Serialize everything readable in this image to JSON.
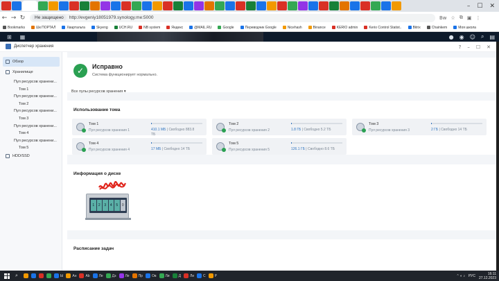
{
  "browser": {
    "security": "Не защищено",
    "url": "http://evgeniy18051979.synology.me:5000",
    "right_controls": [
      "Bw",
      "☆",
      "⧉",
      "▣",
      "⋮"
    ],
    "window_controls": [
      "–",
      "☐",
      "✕"
    ],
    "tab_colors": [
      "#d93025",
      "#1a73e8",
      "#34a853",
      "#f29900",
      "#1a73e8",
      "#d93025",
      "#188038",
      "#e37400",
      "#9334e6",
      "#1a73e8",
      "#d93025",
      "#34a853",
      "#1a73e8",
      "#f29900",
      "#d93025",
      "#188038",
      "#1a73e8",
      "#9334e6",
      "#e37400",
      "#34a853",
      "#1a73e8",
      "#d93025",
      "#188038",
      "#1a73e8",
      "#f29900",
      "#d93025",
      "#34a853",
      "#9334e6",
      "#1a73e8",
      "#d93025",
      "#188038",
      "#e37400",
      "#1a73e8",
      "#d93025",
      "#34a853",
      "#1a73e8",
      "#f29900"
    ]
  },
  "bookmarks": [
    {
      "label": "Bookmarks",
      "color": "#555"
    },
    {
      "label": "Шк ПОРТАЛ",
      "color": "#e37400"
    },
    {
      "label": "Хвартальта",
      "color": "#1a73e8"
    },
    {
      "label": "Skyeng",
      "color": "#1a73e8"
    },
    {
      "label": "UCH.RU",
      "color": "#188038"
    },
    {
      "label": "NB system",
      "color": "#d93025"
    },
    {
      "label": "Яндекс",
      "color": "#d93025"
    },
    {
      "label": "@MAIL.RU",
      "color": "#1a73e8"
    },
    {
      "label": "Google",
      "color": "#34a853"
    },
    {
      "label": "Переводчик Google",
      "color": "#1a73e8"
    },
    {
      "label": "Nicehash",
      "color": "#f29900"
    },
    {
      "label": "Binance",
      "color": "#f29900"
    },
    {
      "label": "KERIO admin",
      "color": "#d93025"
    },
    {
      "label": "Kerio Control Statist..",
      "color": "#d93025"
    },
    {
      "label": "Bitrix",
      "color": "#1a73e8"
    },
    {
      "label": "Chainkem",
      "color": "#555"
    },
    {
      "label": "Моя школа",
      "color": "#1a73e8"
    }
  ],
  "window": {
    "title": "Диспетчер хранения",
    "controls": [
      "?",
      "–",
      "☐",
      "✕"
    ]
  },
  "sidebar": {
    "overview": "Обзор",
    "storage": "Хранилище",
    "items": [
      {
        "label": "Пул ресурсов хранени...",
        "level": 1
      },
      {
        "label": "Том 1",
        "level": 2
      },
      {
        "label": "Пул ресурсов хранени...",
        "level": 1
      },
      {
        "label": "Том 2",
        "level": 2
      },
      {
        "label": "Пул ресурсов хранени...",
        "level": 1
      },
      {
        "label": "Том 3",
        "level": 2
      },
      {
        "label": "Пул ресурсов хранени...",
        "level": 1
      },
      {
        "label": "Том 4",
        "level": 2
      },
      {
        "label": "Пул ресурсов хранени...",
        "level": 1
      },
      {
        "label": "Том 5",
        "level": 2
      }
    ],
    "hdd": "HDD/SSD"
  },
  "status": {
    "title": "Исправно",
    "subtitle": "Система функционирует нормально.",
    "pools_link": "Все пулы ресурсов хранения"
  },
  "volume_usage": {
    "heading": "Использование тома",
    "volumes": [
      {
        "name": "Том 1",
        "pool": "Пул ресурсов хранения 1",
        "used": "410.1 МБ",
        "free": "| Свободно 883.8",
        "free2": "ТБ",
        "fill": 0.01
      },
      {
        "name": "Том 2",
        "pool": "Пул ресурсов хранения 2",
        "used": "1.8 ГБ",
        "free": "| Свободно 5.2 ТБ",
        "free2": "",
        "fill": 0.01
      },
      {
        "name": "Том 3",
        "pool": "Пул ресурсов хранения 3",
        "used": "2 ГБ",
        "free": "| Свободно 14 ТБ",
        "free2": "",
        "fill": 0.01
      },
      {
        "name": "Том 4",
        "pool": "Пул ресурсов хранения 4",
        "used": "17 МБ",
        "free": "| Свободно 14 ТБ",
        "free2": "",
        "fill": 0.01
      },
      {
        "name": "Том 5",
        "pool": "Пул ресурсов хранения 5",
        "used": "126.1 ГБ",
        "free": "| Свободно 8.6 ТБ",
        "free2": "",
        "fill": 0.02
      }
    ]
  },
  "disk_info": {
    "heading": "Информация о диске",
    "bays": [
      "1",
      "2",
      "3",
      "4",
      "5",
      "0"
    ]
  },
  "schedule": {
    "heading": "Расписание задач"
  },
  "taskbar": {
    "apps": [
      {
        "label": "",
        "color": "#f29900"
      },
      {
        "label": "",
        "color": "#1a73e8"
      },
      {
        "label": "",
        "color": "#d93025"
      },
      {
        "label": "",
        "color": "#34a853"
      },
      {
        "label": "Ы",
        "color": "#1a73e8"
      },
      {
        "label": "Ан",
        "color": "#f29900"
      },
      {
        "label": "Ab",
        "color": "#d93025"
      },
      {
        "label": "Ле",
        "color": "#1a73e8"
      },
      {
        "label": "Дз",
        "color": "#34a853"
      },
      {
        "label": "Ле",
        "color": "#9334e6"
      },
      {
        "label": "Пр",
        "color": "#e37400"
      },
      {
        "label": "Ов",
        "color": "#1a73e8"
      },
      {
        "label": "Ли",
        "color": "#34a853"
      },
      {
        "label": "Д",
        "color": "#188038"
      },
      {
        "label": "Ли",
        "color": "#d93025"
      },
      {
        "label": "С",
        "color": "#1a73e8"
      },
      {
        "label": "Р",
        "color": "#f29900"
      }
    ],
    "lang": "РУС",
    "time": "16:11",
    "date": "27.12.2023"
  },
  "watermark": "Avito"
}
